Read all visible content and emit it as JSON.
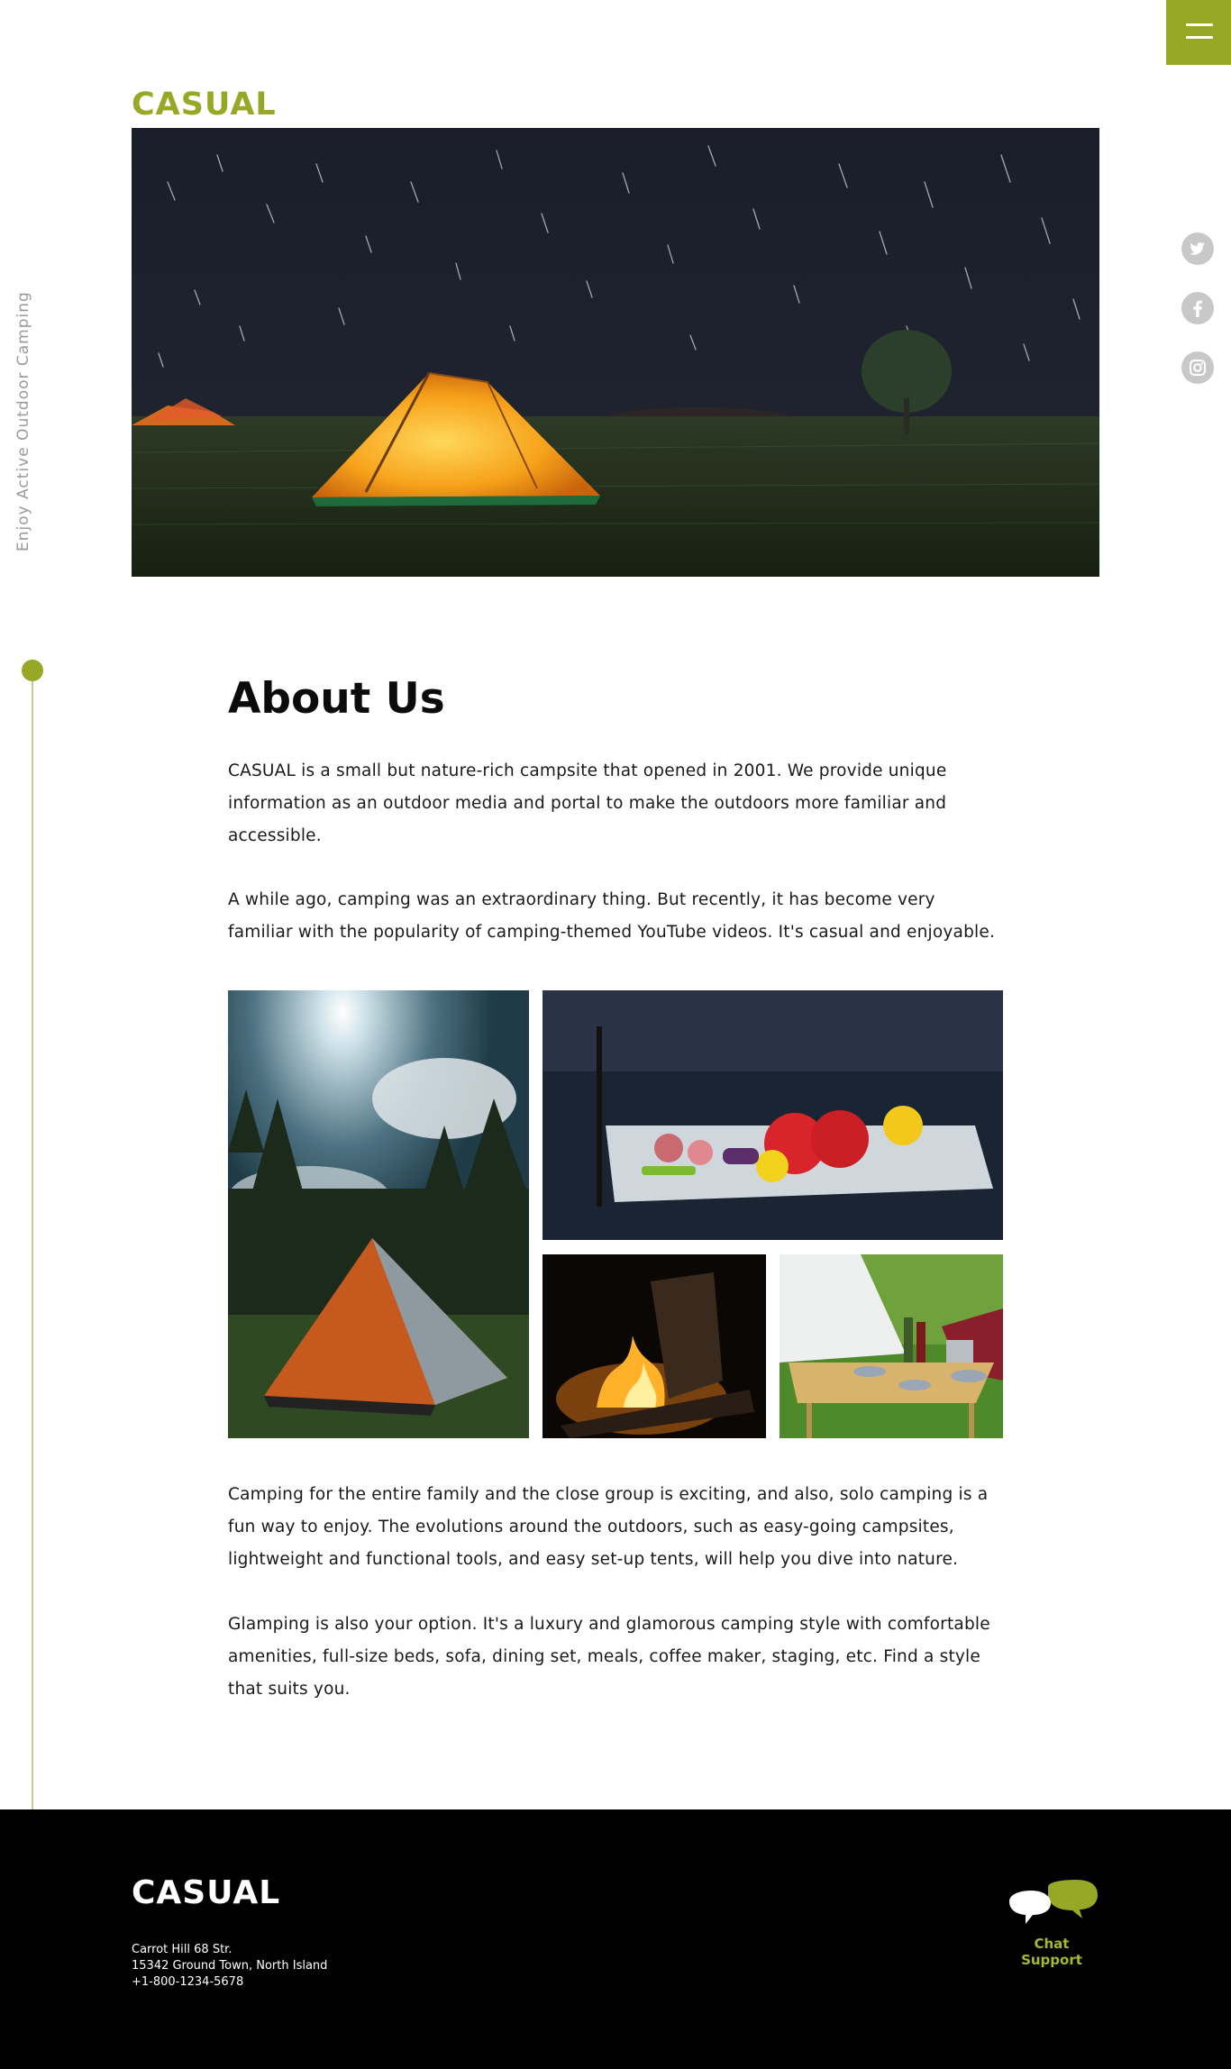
{
  "brand": {
    "name": "CASUAL",
    "accent_color": "#97a726"
  },
  "menu": {
    "icon": "hamburger-icon"
  },
  "hero": {
    "image": "night-camp-tent-under-star-trails"
  },
  "sidebar": {
    "tagline": "Enjoy Active Outdoor Camping"
  },
  "social": [
    {
      "icon": "twitter-icon"
    },
    {
      "icon": "facebook-icon"
    },
    {
      "icon": "instagram-icon"
    }
  ],
  "about": {
    "title": "About Us",
    "paragraphs": [
      "CASUAL is a small but nature-rich campsite that opened in 2001. We provide unique information as an outdoor media and portal to make the outdoors more familiar and accessible.",
      "A while ago, camping was an extraordinary thing. But recently, it has become very familiar with the popularity of camping-themed YouTube videos. It's casual and enjoyable.",
      "Camping for the entire family and the close group is exciting, and also, solo camping is a fun way to enjoy. The evolutions around the outdoors, such as easy-going campsites, lightweight and functional tools, and easy set-up tents, will help you dive into nature.",
      "Glamping is also your option. It's a luxury and glamorous camping style with comfortable amenities, full-size beds, sofa, dining set, meals, coffee maker, staging, etc. Find a style that suits you."
    ],
    "gallery": [
      {
        "image": "tent-in-forest"
      },
      {
        "image": "grilled-vegetables"
      },
      {
        "image": "campfire"
      },
      {
        "image": "glamping-table"
      }
    ]
  },
  "footer": {
    "logo": "CASUAL",
    "address": [
      "Carrot Hill 68 Str.",
      "15342  Ground Town, North Island",
      "+1-800-1234-5678"
    ],
    "chat_label": "Chat Support",
    "chat_icon": "chat-bubbles-icon"
  }
}
